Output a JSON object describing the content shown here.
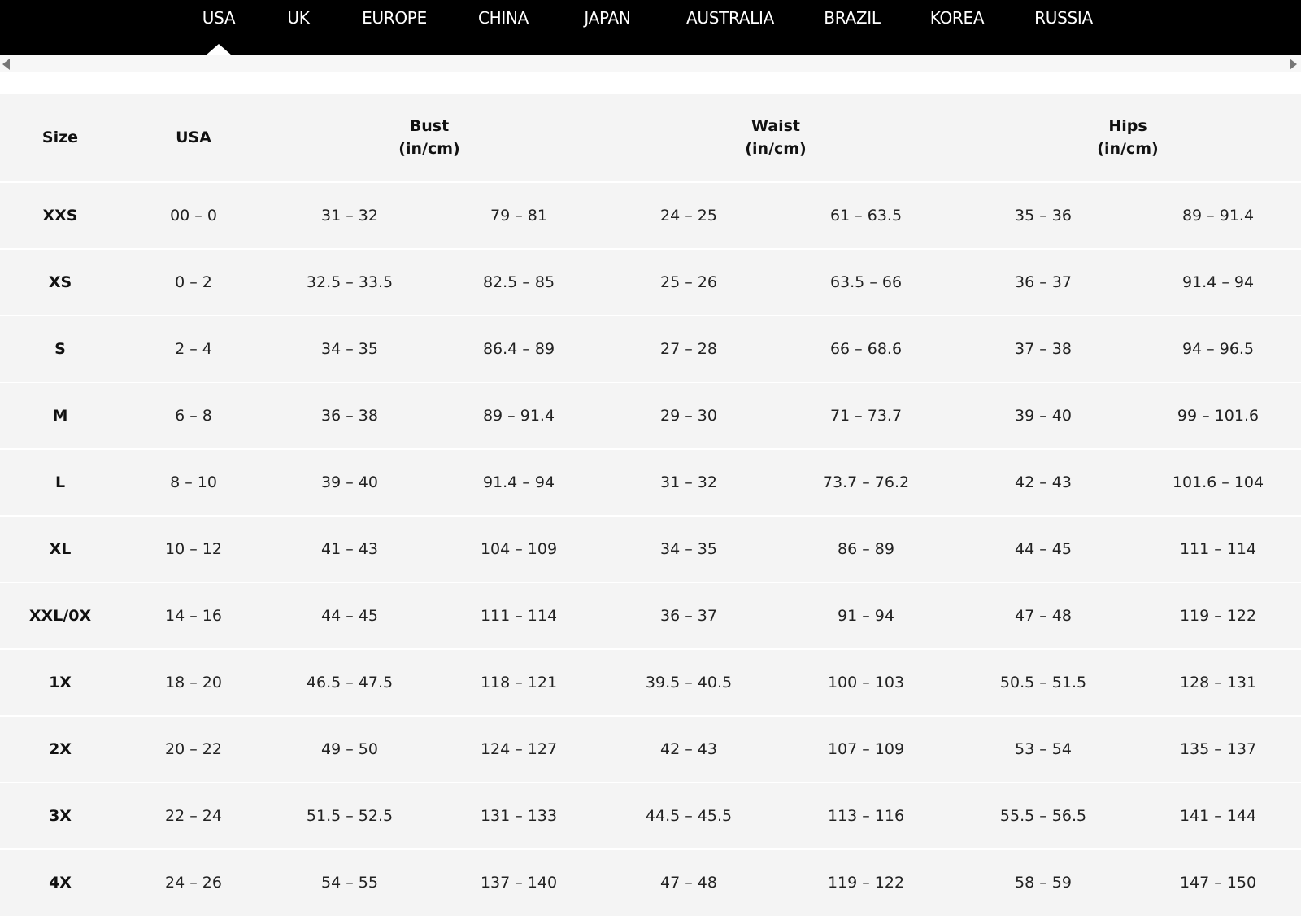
{
  "tabs": [
    {
      "label": "USA",
      "selected": true
    },
    {
      "label": "UK",
      "selected": false
    },
    {
      "label": "EUROPE",
      "selected": false
    },
    {
      "label": "CHINA",
      "selected": false
    },
    {
      "label": "JAPAN",
      "selected": false
    },
    {
      "label": "AUSTRALIA",
      "selected": false
    },
    {
      "label": "BRAZIL",
      "selected": false
    },
    {
      "label": "KOREA",
      "selected": false
    },
    {
      "label": "RUSSIA",
      "selected": false
    }
  ],
  "table": {
    "headers": {
      "size": "Size",
      "usa": "USA",
      "bust": {
        "title": "Bust",
        "unit": "(in/cm)"
      },
      "waist": {
        "title": "Waist",
        "unit": "(in/cm)"
      },
      "hips": {
        "title": "Hips",
        "unit": "(in/cm)"
      }
    },
    "rows": [
      [
        "XXS",
        "00 – 0",
        "31 – 32",
        "79 – 81",
        "24 – 25",
        "61 – 63.5",
        "35 – 36",
        "89 – 91.4"
      ],
      [
        "XS",
        "0 – 2",
        "32.5 – 33.5",
        "82.5 – 85",
        "25 – 26",
        "63.5 – 66",
        "36 – 37",
        "91.4 – 94"
      ],
      [
        "S",
        "2 – 4",
        "34 – 35",
        "86.4 – 89",
        "27 – 28",
        "66 – 68.6",
        "37 – 38",
        "94 – 96.5"
      ],
      [
        "M",
        "6 – 8",
        "36 – 38",
        "89 – 91.4",
        "29 – 30",
        "71 – 73.7",
        "39 – 40",
        "99 – 101.6"
      ],
      [
        "L",
        "8 – 10",
        "39 – 40",
        "91.4 – 94",
        "31 – 32",
        "73.7 – 76.2",
        "42 – 43",
        "101.6 – 104"
      ],
      [
        "XL",
        "10 – 12",
        "41 – 43",
        "104 – 109",
        "34 – 35",
        "86 – 89",
        "44 – 45",
        "111 – 114"
      ],
      [
        "XXL/0X",
        "14 – 16",
        "44 – 45",
        "111 – 114",
        "36 – 37",
        "91 – 94",
        "47 – 48",
        "119 – 122"
      ],
      [
        "1X",
        "18 – 20",
        "46.5 – 47.5",
        "118 – 121",
        "39.5 – 40.5",
        "100 – 103",
        "50.5 – 51.5",
        "128 – 131"
      ],
      [
        "2X",
        "20 – 22",
        "49 – 50",
        "124 – 127",
        "42 – 43",
        "107 – 109",
        "53 – 54",
        "135 – 137"
      ],
      [
        "3X",
        "22 – 24",
        "51.5 – 52.5",
        "131 – 133",
        "44.5 – 45.5",
        "113 – 116",
        "55.5 – 56.5",
        "141 – 144"
      ],
      [
        "4X",
        "24 – 26",
        "54 – 55",
        "137 – 140",
        "47 – 48",
        "119 – 122",
        "58 – 59",
        "147 – 150"
      ]
    ]
  }
}
